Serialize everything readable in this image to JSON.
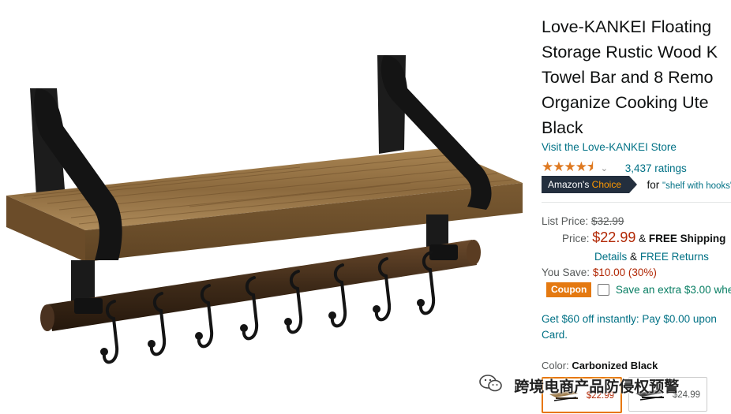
{
  "product": {
    "title_lines": [
      "Love-KANKEI Floating",
      "Storage Rustic Wood K",
      "Towel Bar and 8 Remo",
      "Organize Cooking Ute",
      "Black"
    ],
    "store_link": "Visit the Love-KANKEI Store",
    "stars_glyphs": "★★★★⯨",
    "rating_value": 4.5,
    "ratings_count": "3,437 ratings",
    "choice_badge": {
      "prefix": "Amazon's",
      "accent": "Choice"
    },
    "choice_for": "for",
    "choice_query": "\"shelf with hooks\""
  },
  "pricing": {
    "list_price_label": "List Price:",
    "list_price": "$32.99",
    "price_label": "Price:",
    "price": "$22.99",
    "amp": "&",
    "free_shipping": "FREE Shipping",
    "details": "Details",
    "amp2": "&",
    "free_returns": "FREE Returns",
    "you_save_label": "You Save:",
    "you_save": "$10.00 (30%)",
    "coupon_badge": "Coupon",
    "coupon_text": "Save an extra $3.00 whe"
  },
  "promo": {
    "line1": "Get $60 off instantly: Pay $0.00 upon",
    "line2": "Card."
  },
  "variant": {
    "color_label": "Color:",
    "color_value": "Carbonized Black",
    "swatches": [
      {
        "price": "$22.99",
        "selected": true
      },
      {
        "price": "$24.99",
        "selected": false
      }
    ]
  },
  "watermark": {
    "text": "跨境电商产品防侵权预警"
  },
  "colors": {
    "link": "#007185",
    "price_red": "#b12704",
    "star": "#de7921",
    "badge_dark": "#232f3e",
    "badge_accent": "#ff9900",
    "coupon_orange": "#e47911",
    "coupon_green": "#067d62",
    "selected_border": "#e77600"
  }
}
